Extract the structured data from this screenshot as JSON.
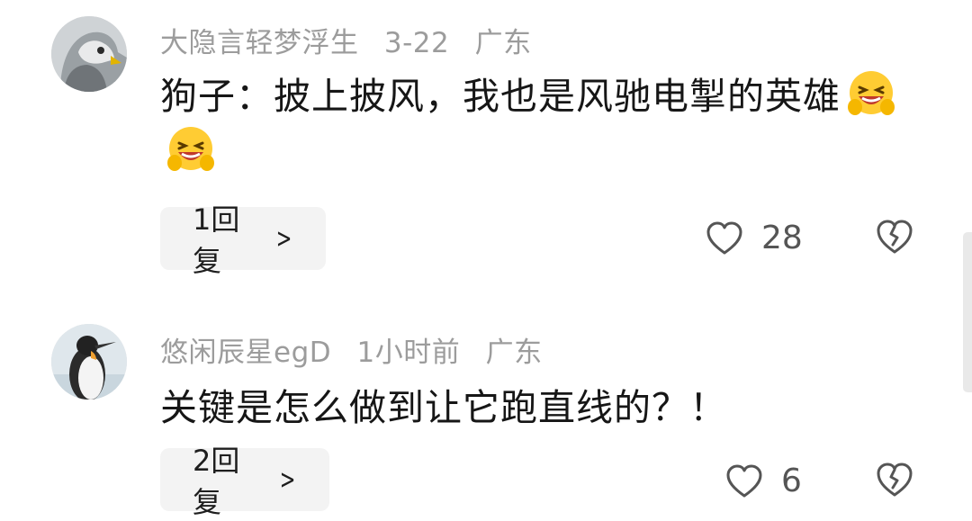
{
  "comments": [
    {
      "username": "大隐言轻梦浮生",
      "date": "3-22",
      "location": "广东",
      "text": "狗子：披上披风，我也是风驰电掣的英雄",
      "emojis": [
        "grinning-squint-victory-emoji",
        "grinning-squint-victory-emoji"
      ],
      "reply_label": "1回复",
      "like_count": "28",
      "avatar_icon": "eagle-avatar"
    },
    {
      "username": "悠闲辰星egD",
      "date": "1小时前",
      "location": "广东",
      "text": "关键是怎么做到让它跑直线的？！",
      "emojis": [],
      "reply_label": "2回复",
      "like_count": "6",
      "avatar_icon": "penguin-avatar"
    }
  ],
  "icons": {
    "like": "heart-outline-icon",
    "dislike": "broken-heart-icon",
    "chevron": "chevron-right-icon"
  },
  "chevron_glyph": ">"
}
